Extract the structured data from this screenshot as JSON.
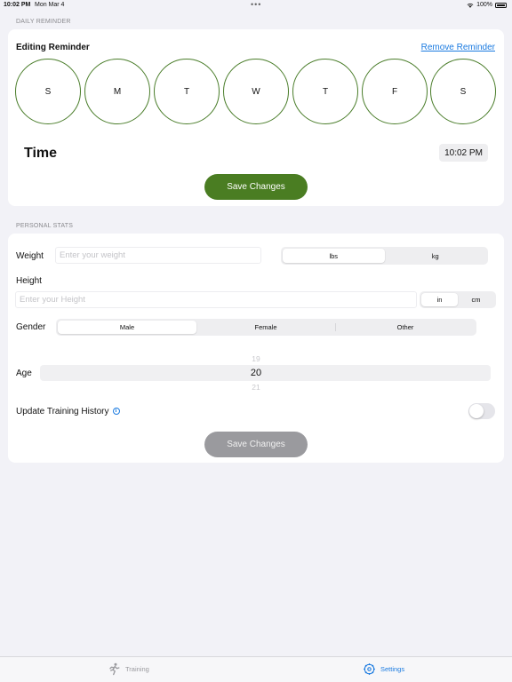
{
  "status_bar": {
    "time": "10:02 PM",
    "date": "Mon Mar 4",
    "dots": "•••",
    "battery": "100%"
  },
  "daily_reminder": {
    "section_label": "DAILY REMINDER",
    "editing_title": "Editing Reminder",
    "remove_label": "Remove Reminder",
    "days": [
      "S",
      "M",
      "T",
      "W",
      "T",
      "F",
      "S"
    ],
    "time_label": "Time",
    "time_value": "10:02 PM",
    "save_label": "Save Changes"
  },
  "personal_stats": {
    "section_label": "PERSONAL STATS",
    "weight_label": "Weight",
    "weight_placeholder": "Enter your weight",
    "weight_units": [
      "lbs",
      "kg"
    ],
    "weight_unit_selected": "lbs",
    "height_label": "Height",
    "height_placeholder": "Enter your Height",
    "height_units": [
      "in",
      "cm"
    ],
    "height_unit_selected": "in",
    "gender_label": "Gender",
    "gender_options": [
      "Male",
      "Female",
      "Other"
    ],
    "gender_selected": "Male",
    "age_label": "Age",
    "age_prev": "19",
    "age_value": "20",
    "age_next": "21",
    "update_history_label": "Update Training History",
    "update_history_on": false,
    "save_label": "Save Changes"
  },
  "tab_bar": {
    "training_label": "Training",
    "settings_label": "Settings",
    "active_tab": "Settings"
  },
  "colors": {
    "accent_green": "#4a7d22",
    "link_blue": "#1a7ae0",
    "disabled_gray": "#9a9a9e",
    "background": "#f2f2f7"
  }
}
